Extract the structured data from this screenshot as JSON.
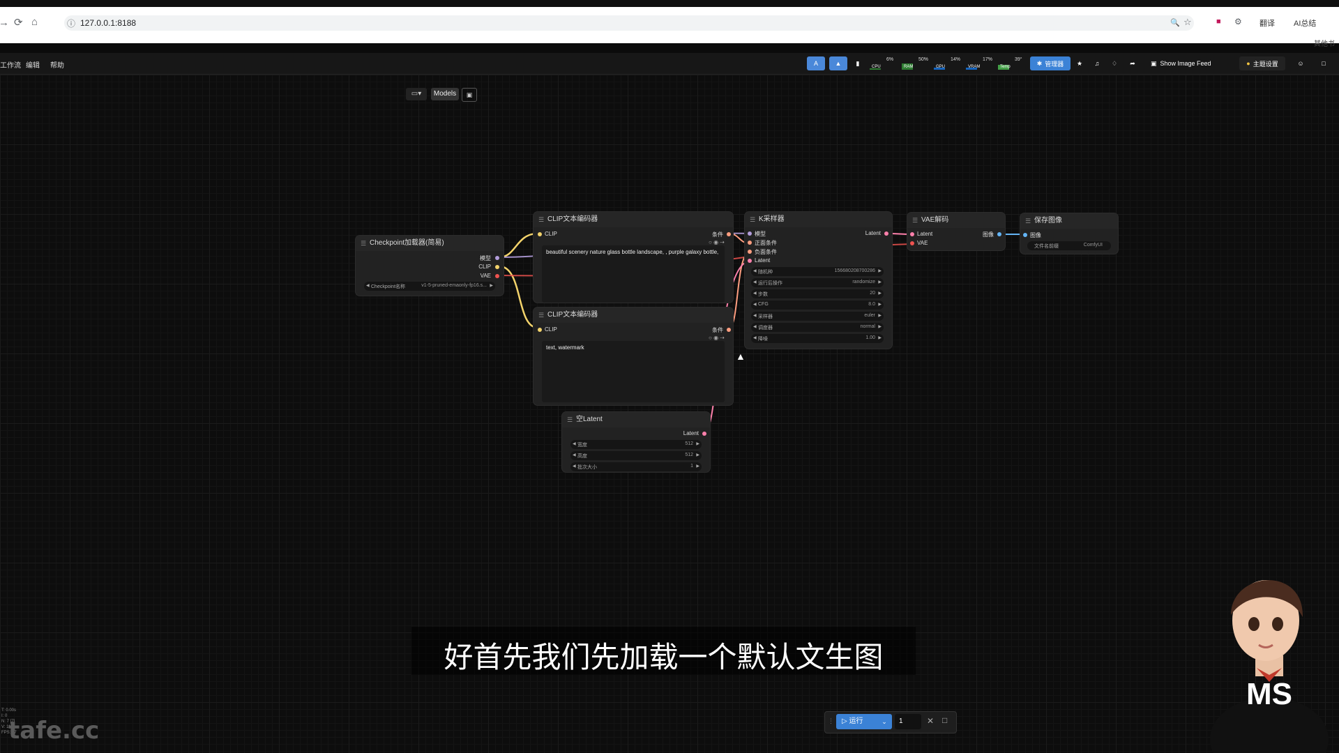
{
  "browser": {
    "url": "127.0.0.1:8188",
    "translate_label": "翻译",
    "ai_label": "AI总结",
    "bookmark_label": "其他书"
  },
  "menubar": {
    "items": [
      "工作流",
      "编辑",
      "帮助"
    ],
    "monitors": [
      {
        "label": "CPU",
        "value": "6%",
        "color": "#2e7d32",
        "level": 0.06
      },
      {
        "label": "RAM",
        "value": "50%",
        "color": "#2e7d32",
        "level": 0.5
      },
      {
        "label": "GPU",
        "value": "14%",
        "color": "#1565c0",
        "level": 0.14
      },
      {
        "label": "VRAM",
        "value": "17%",
        "color": "#1565c0",
        "level": 0.17
      },
      {
        "label": "Temp",
        "value": "39°",
        "color": "#43a047",
        "level": 0.39
      }
    ],
    "manager_label": "管理器",
    "feed_label": "Show Image Feed",
    "theme_label": "主题设置"
  },
  "canvas_toolbar": {
    "models_label": "Models"
  },
  "nodes": {
    "checkpoint": {
      "title": "Checkpoint加载器(简易)",
      "outputs": [
        "模型",
        "CLIP",
        "VAE"
      ],
      "widget_label": "Checkpoint名称",
      "widget_value": "v1-5-pruned-emaonly-fp16.s..."
    },
    "clip_pos": {
      "title": "CLIP文本编码器",
      "input": "CLIP",
      "output": "条件",
      "text": "beautiful scenery nature glass bottle landscape, , purple galaxy bottle,"
    },
    "clip_neg": {
      "title": "CLIP文本编码器",
      "input": "CLIP",
      "output": "条件",
      "text": "text, watermark"
    },
    "ksampler": {
      "title": "K采样器",
      "inputs": [
        "模型",
        "正面条件",
        "负面条件",
        "Latent"
      ],
      "output": "Latent",
      "widgets": [
        {
          "label": "随机种",
          "value": "156680208700286"
        },
        {
          "label": "运行后操作",
          "value": "randomize"
        },
        {
          "label": "步数",
          "value": "20"
        },
        {
          "label": "CFG",
          "value": "8.0"
        },
        {
          "label": "采样器",
          "value": "euler"
        },
        {
          "label": "调度器",
          "value": "normal"
        },
        {
          "label": "降噪",
          "value": "1.00"
        }
      ]
    },
    "vae_decode": {
      "title": "VAE解码",
      "inputs": [
        "Latent",
        "VAE"
      ],
      "output": "图像"
    },
    "save_image": {
      "title": "保存图像",
      "input": "图像",
      "widget_label": "文件名前缀",
      "widget_value": "ComfyUI"
    },
    "empty_latent": {
      "title": "空Latent",
      "output": "Latent",
      "widgets": [
        {
          "label": "宽度",
          "value": "512"
        },
        {
          "label": "高度",
          "value": "512"
        },
        {
          "label": "批次大小",
          "value": "1"
        }
      ]
    }
  },
  "subtitle": "好首先我们先加载一个默认文生图",
  "runbar": {
    "run_label": "运行",
    "count": "1"
  },
  "watermark": "tafe.cc",
  "avatar_text": "MS",
  "corner_stats": [
    "T: 0.00s",
    "I: 0",
    "N: 7 [7]",
    "V: 11",
    "FPS: 47"
  ]
}
